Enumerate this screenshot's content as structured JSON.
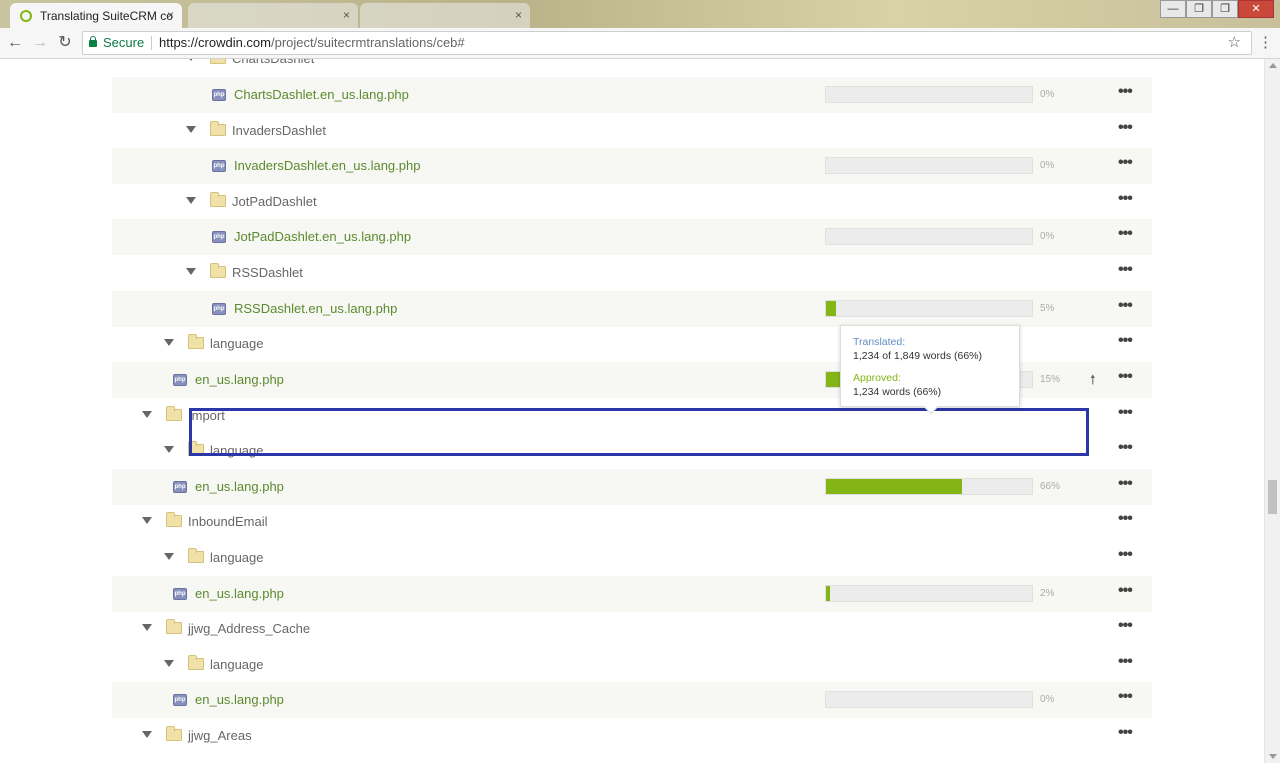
{
  "browser": {
    "tabs": [
      {
        "title": "Translating SuiteCRM co",
        "active": true
      },
      {
        "title": "",
        "active": false
      },
      {
        "title": "",
        "active": false
      }
    ],
    "secure_label": "Secure",
    "url_host": "https://crowdin.com",
    "url_path": "/project/suitecrmtranslations/ceb#",
    "tab_close": "×",
    "star_icon": "☆",
    "menu_icon": "⋮",
    "win_minimize": "—",
    "win_restore": "❐",
    "win_close": "✕",
    "back_icon": "←",
    "forward_icon": "→",
    "reload_icon": "↻"
  },
  "tree": {
    "rows": [
      {
        "name": "ChartsDashlet",
        "type": "folder"
      },
      {
        "name": "ChartsDashlet.en_us.lang.php",
        "type": "file",
        "percent": "0%",
        "progress": 0
      },
      {
        "name": "InvadersDashlet",
        "type": "folder"
      },
      {
        "name": "InvadersDashlet.en_us.lang.php",
        "type": "file",
        "percent": "0%",
        "progress": 0
      },
      {
        "name": "JotPadDashlet",
        "type": "folder"
      },
      {
        "name": "JotPadDashlet.en_us.lang.php",
        "type": "file",
        "percent": "0%",
        "progress": 0
      },
      {
        "name": "RSSDashlet",
        "type": "folder"
      },
      {
        "name": "RSSDashlet.en_us.lang.php",
        "type": "file",
        "percent": "5%",
        "progress": 5
      },
      {
        "name": "language",
        "type": "folder"
      },
      {
        "name": "en_us.lang.php",
        "type": "file",
        "percent": "15%",
        "progress": 15
      },
      {
        "name": "Import",
        "type": "folder"
      },
      {
        "name": "language",
        "type": "folder"
      },
      {
        "name": "en_us.lang.php",
        "type": "file",
        "percent": "66%",
        "progress": 66
      },
      {
        "name": "InboundEmail",
        "type": "folder"
      },
      {
        "name": "language",
        "type": "folder"
      },
      {
        "name": "en_us.lang.php",
        "type": "file",
        "percent": "2%",
        "progress": 2
      },
      {
        "name": "jjwg_Address_Cache",
        "type": "folder"
      },
      {
        "name": "language",
        "type": "folder"
      },
      {
        "name": "en_us.lang.php",
        "type": "file",
        "percent": "0%",
        "progress": 0
      },
      {
        "name": "jjwg_Areas",
        "type": "folder"
      }
    ],
    "more_icon": "•••",
    "upload_icon": "🠕",
    "php_badge": "php"
  },
  "tooltip": {
    "translated_label": "Translated:",
    "translated_value": "1,234 of 1,849 words (66%)",
    "approved_label": "Approved:",
    "approved_value": "1,234 words (66%)"
  },
  "colors": {
    "accent_green": "#84b517",
    "highlight_blue": "#2b37a8",
    "file_link": "#5c8a2e"
  }
}
